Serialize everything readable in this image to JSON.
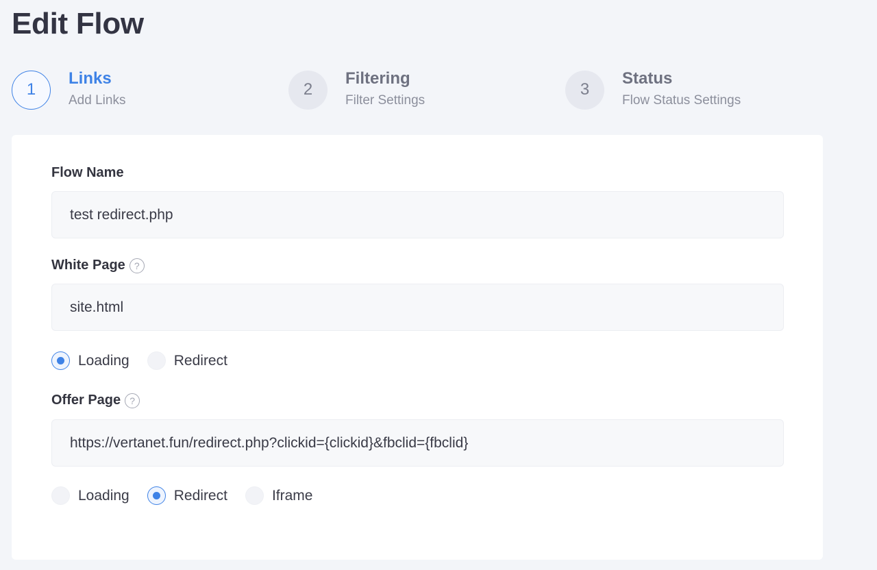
{
  "page": {
    "title": "Edit Flow"
  },
  "steps": [
    {
      "number": "1",
      "title": "Links",
      "subtitle": "Add Links",
      "active": true
    },
    {
      "number": "2",
      "title": "Filtering",
      "subtitle": "Filter Settings",
      "active": false
    },
    {
      "number": "3",
      "title": "Status",
      "subtitle": "Flow Status Settings",
      "active": false
    }
  ],
  "form": {
    "flow_name": {
      "label": "Flow Name",
      "value": "test redirect.php"
    },
    "white_page": {
      "label": "White Page",
      "help_icon": "?",
      "value": "site.html",
      "options": [
        {
          "label": "Loading",
          "checked": true
        },
        {
          "label": "Redirect",
          "checked": false
        }
      ]
    },
    "offer_page": {
      "label": "Offer Page",
      "help_icon": "?",
      "value": "https://vertanet.fun/redirect.php?clickid={clickid}&fbclid={fbclid}",
      "options": [
        {
          "label": "Loading",
          "checked": false
        },
        {
          "label": "Redirect",
          "checked": true
        },
        {
          "label": "Iframe",
          "checked": false
        }
      ]
    }
  },
  "colors": {
    "accent": "#3e82e6",
    "background": "#f3f5f9",
    "card": "#ffffff"
  }
}
